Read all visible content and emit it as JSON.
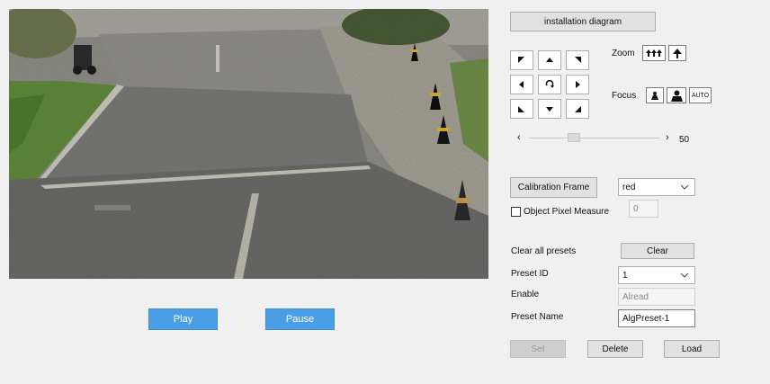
{
  "player": {
    "play_label": "Play",
    "pause_label": "Pause"
  },
  "ptz": {
    "install_label": "installation diagram",
    "zoom_label": "Zoom",
    "focus_label": "Focus",
    "focus_auto_label": "AUTO",
    "slider_value": "50",
    "slider_level": 0.33,
    "icons": [
      "up-left-arrow-icon",
      "up-arrow-icon",
      "up-right-arrow-icon",
      "left-arrow-icon",
      "rotate-icon",
      "right-arrow-icon",
      "down-left-arrow-icon",
      "down-arrow-icon",
      "down-right-arrow-icon"
    ]
  },
  "calibration": {
    "frame_button": "Calibration Frame",
    "color_selected": "red",
    "pixel_measure_label": "Object Pixel Measure",
    "pixel_measure_value": "0"
  },
  "presets": {
    "clear_all_label": "Clear all presets",
    "clear_button": "Clear",
    "id_label": "Preset ID",
    "id_selected": "1",
    "enable_label": "Enable",
    "enable_value": "Alread",
    "name_label": "Preset Name",
    "name_value": "AlgPreset-1",
    "set_button": "Set",
    "delete_button": "Delete",
    "load_button": "Load"
  },
  "colors": {
    "button_blue": "#4a9ee6",
    "panel_bg": "#f0f0f0"
  }
}
